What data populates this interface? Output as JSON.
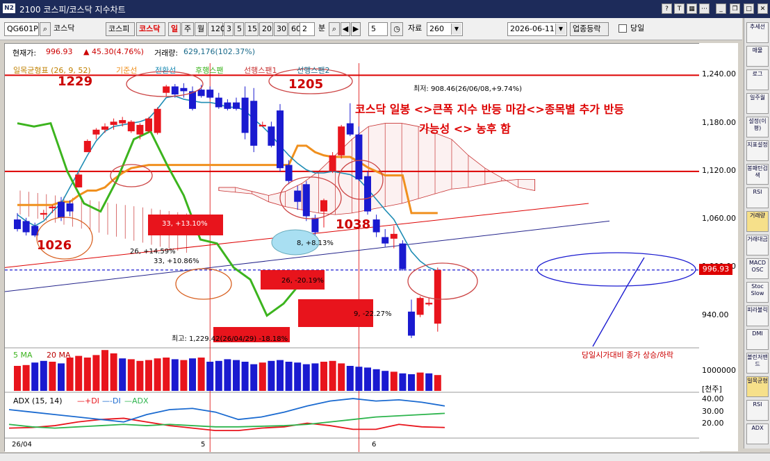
{
  "window": {
    "title": "2100 코스피/코스닥 지수차트",
    "logo": "N2"
  },
  "toolbar": {
    "code": "QG601P",
    "market_name": "코스닥",
    "btn_kospi": "코스피",
    "btn_kosdaq": "코스닥",
    "period_day": "일",
    "period_week": "주",
    "period_month": "월",
    "minute_options": [
      "120",
      "3",
      "5",
      "15",
      "20",
      "30",
      "60"
    ],
    "interval_value": "2",
    "interval_unit": "분",
    "count_value": "5",
    "data_label": "자료",
    "data_count": "260",
    "date_value": "2026-06-11",
    "sector_button": "업종등락",
    "today_label": "당일"
  },
  "stats": {
    "current_label": "현재가:",
    "current_value": "996.93",
    "change": "▲ 45.30(4.76%)",
    "volume_label": "거래량:",
    "volume_value": "629,176(102.37%)"
  },
  "legends": {
    "ichimoku": "일목균형표 (26, 9, 52)",
    "base": "기준선",
    "conversion": "전환선",
    "lagging": "후행스팬",
    "leading1": "선행스팬1",
    "leading2": "선행스팬2",
    "ma5": "5 MA",
    "ma20": "20 MA",
    "adx_title": "ADX (15, 14)",
    "plus_di": "+DI",
    "minus_di": "-DI",
    "adx": "ADX",
    "volume_note": "당일시가대비 종가 상승/하락"
  },
  "annotations": {
    "headline_1": "코스닥 일봉 <>큰폭  지수 반등 마감<>종목별 추가 반등",
    "headline_2": "가능성 <> 농후 함",
    "high_1229": "1229",
    "high_1205": "1205",
    "low_1026": "1026",
    "low_1038": "1038",
    "recent_low": "최저: 908.46(26/06/08,+9.74%)",
    "lbl_33a": "33, +13.10%",
    "lbl_26a": "26, +14.59%",
    "lbl_33b": "33, +10.86%",
    "lbl_8": "8, +8.13%",
    "lbl_26b": "26, -20.19%",
    "lbl_9": "9, -22.27%",
    "lbl_low": "최고: 1,229.42(26/04/29) -18.18%"
  },
  "axis": {
    "price_ticks": [
      "1,240.00",
      "1,180.00",
      "1,120.00",
      "1,060.00",
      "1,000.00",
      "940.00"
    ],
    "current_price_tag": "996.93",
    "volume_tick": "1000000",
    "volume_unit": "[천주]",
    "adx_ticks": [
      "40.00",
      "30.00",
      "20.00"
    ],
    "x_labels": [
      "26/04",
      "5",
      "6"
    ]
  },
  "sidepanel": [
    "추세선",
    "매물",
    "로그",
    "일주월",
    "설정(이평)",
    "지표설정",
    "봉패턴검색",
    "RSI",
    "거래량",
    "거래대금",
    "MACD OSC",
    "Stoc Slow",
    "피라불릭",
    "DMI",
    "볼린저밴드",
    "일목균형",
    "RSI",
    "ADX"
  ],
  "colors": {
    "up": "#e8141c",
    "down": "#1a1ad0",
    "base_line": "#f0901e",
    "conversion_line": "#1e8cb4",
    "lagging_line": "#3cb41e",
    "cloud": "#c83232",
    "titlebar": "#1d2b5a"
  },
  "chart_data": [
    {
      "type": "candlestick",
      "title": "일목균형표 (26, 9, 52)",
      "ylim": [
        905,
        1255
      ],
      "ohlc": [
        [
          1060,
          1068,
          1045,
          1048
        ],
        [
          1058,
          1062,
          1040,
          1044
        ],
        [
          1052,
          1056,
          1038,
          1040
        ],
        [
          1066,
          1072,
          1060,
          1068
        ],
        [
          1074,
          1078,
          1068,
          1076
        ],
        [
          1082,
          1088,
          1058,
          1062
        ],
        [
          1080,
          1084,
          1064,
          1070
        ],
        [
          1100,
          1118,
          1100,
          1116
        ],
        [
          1144,
          1160,
          1144,
          1158
        ],
        [
          1166,
          1174,
          1160,
          1172
        ],
        [
          1172,
          1180,
          1168,
          1176
        ],
        [
          1178,
          1186,
          1172,
          1182
        ],
        [
          1180,
          1188,
          1176,
          1184
        ],
        [
          1170,
          1184,
          1168,
          1182
        ],
        [
          1166,
          1180,
          1160,
          1178
        ],
        [
          1170,
          1188,
          1168,
          1186
        ],
        [
          1168,
          1200,
          1166,
          1198
        ],
        [
          1218,
          1228,
          1214,
          1226
        ],
        [
          1226,
          1229,
          1212,
          1216
        ],
        [
          1224,
          1230,
          1212,
          1220
        ],
        [
          1220,
          1226,
          1196,
          1198
        ],
        [
          1222,
          1228,
          1212,
          1214
        ],
        [
          1222,
          1226,
          1210,
          1212
        ],
        [
          1212,
          1218,
          1198,
          1200
        ],
        [
          1206,
          1210,
          1196,
          1198
        ],
        [
          1206,
          1212,
          1196,
          1198
        ],
        [
          1212,
          1226,
          1160,
          1168
        ],
        [
          1208,
          1224,
          1144,
          1152
        ],
        [
          1176,
          1182,
          1178,
          1178
        ],
        [
          1176,
          1182,
          1150,
          1152
        ],
        [
          1196,
          1204,
          1120,
          1124
        ],
        [
          1128,
          1134,
          1104,
          1108
        ],
        [
          1096,
          1102,
          1072,
          1082
        ],
        [
          1104,
          1108,
          1058,
          1064
        ],
        [
          1062,
          1066,
          1040,
          1044
        ],
        [
          1070,
          1086,
          1050,
          1084
        ],
        [
          1120,
          1144,
          1118,
          1140
        ],
        [
          1140,
          1178,
          1136,
          1176
        ],
        [
          1180,
          1205,
          1164,
          1166
        ],
        [
          1166,
          1176,
          1108,
          1110
        ],
        [
          1114,
          1120,
          1066,
          1070
        ],
        [
          1060,
          1066,
          1038,
          1044
        ],
        [
          1038,
          1048,
          1026,
          1030
        ],
        [
          1036,
          1052,
          1024,
          1042
        ],
        [
          1030,
          1034,
          996,
          998
        ],
        [
          945,
          960,
          912,
          915
        ],
        [
          941,
          964,
          938,
          962
        ],
        [
          954,
          962,
          952,
          956
        ],
        [
          930,
          1000,
          920,
          996.93
        ]
      ],
      "base_line": [
        1078,
        1078,
        1078,
        1078,
        1078,
        1082,
        1082,
        1090,
        1096,
        1096,
        1100,
        1110,
        1118,
        1124,
        1126,
        1128,
        1128,
        1128,
        1128,
        1128,
        1128,
        1128,
        1128,
        1128,
        1128,
        1128,
        1128,
        1128,
        1128,
        1128,
        1128,
        1128,
        1152,
        1152,
        1144,
        1140,
        1138,
        1138,
        1138,
        1132,
        1125,
        1120,
        1115,
        1115,
        1115,
        1068,
        1068,
        1068,
        1068
      ],
      "conversion_line": [
        1066,
        1058,
        1052,
        1058,
        1070,
        1080,
        1100,
        1120,
        1140,
        1158,
        1170,
        1176,
        1178,
        1180,
        1182,
        1186,
        1198,
        1212,
        1214,
        1210,
        1208,
        1206,
        1206,
        1204,
        1200,
        1200,
        1196,
        1185,
        1176,
        1165,
        1152,
        1140,
        1130,
        1122,
        1118,
        1118,
        1120,
        1118,
        1116,
        1110,
        1098,
        1085,
        1072,
        1060,
        1040,
        1020,
        1008,
        1000,
        996
      ],
      "lagging_span": [
        1180,
        1176,
        1180,
        1120,
        1080,
        1070,
        1110,
        1160,
        1170,
        1128,
        1090,
        1035,
        1030,
        1000,
        985,
        940,
        955,
        980,
        995
      ],
      "cloud_span_a": [
        1100,
        1100,
        1095,
        1090,
        1095,
        1105,
        1120,
        1140,
        1160,
        1176,
        1180,
        1180,
        1176,
        1168,
        1160,
        1140,
        1124,
        1112,
        1100,
        1096
      ],
      "cloud_span_b": [
        1096,
        1094,
        1092,
        1082,
        1076,
        1072,
        1068,
        1066,
        1068,
        1072,
        1076,
        1080,
        1086,
        1092,
        1098,
        1100,
        1104,
        1108,
        1110,
        1110
      ],
      "hlines": [
        1240,
        1120,
        996.93
      ]
    },
    {
      "type": "bar",
      "title": "거래량",
      "series": [
        {
          "name": "5 MA",
          "values": []
        },
        {
          "name": "20 MA",
          "values": []
        }
      ],
      "values": [
        60,
        62,
        68,
        72,
        70,
        66,
        80,
        84,
        80,
        86,
        98,
        90,
        78,
        76,
        72,
        74,
        78,
        80,
        76,
        74,
        78,
        80,
        70,
        72,
        76,
        74,
        70,
        64,
        68,
        72,
        74,
        70,
        68,
        64,
        66,
        70,
        72,
        66,
        60,
        58,
        56,
        52,
        48,
        46,
        42,
        40,
        44,
        42,
        38
      ],
      "up": [
        true,
        true,
        false,
        false,
        true,
        false,
        true,
        true,
        true,
        true,
        true,
        true,
        false,
        true,
        true,
        true,
        true,
        true,
        false,
        true,
        false,
        true,
        false,
        false,
        false,
        false,
        false,
        false,
        true,
        false,
        false,
        false,
        false,
        false,
        false,
        true,
        true,
        true,
        false,
        false,
        false,
        false,
        false,
        true,
        false,
        false,
        true,
        false,
        true
      ]
    },
    {
      "type": "line",
      "title": "ADX (15, 14)",
      "ylim": [
        10,
        45
      ],
      "series": [
        {
          "name": "+DI",
          "values": [
            17,
            17.5,
            19,
            22,
            24,
            25,
            22,
            19,
            17,
            15,
            15,
            17,
            18,
            21,
            19,
            16,
            16,
            20,
            18,
            17.5
          ]
        },
        {
          "name": "-DI",
          "values": [
            32,
            30,
            28,
            26,
            24,
            22,
            28,
            32,
            33,
            30,
            24,
            26,
            30,
            35,
            39,
            41,
            39,
            40,
            38,
            35
          ]
        },
        {
          "name": "ADX",
          "values": [
            20,
            18,
            17,
            18,
            19,
            20,
            19,
            20,
            19,
            18,
            18,
            18.5,
            19,
            20,
            22,
            24,
            26,
            27,
            28,
            29
          ]
        }
      ]
    }
  ]
}
